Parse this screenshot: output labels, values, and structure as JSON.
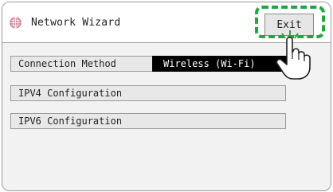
{
  "window": {
    "title": "Network Wizard",
    "icon": "globe-icon"
  },
  "toolbar": {
    "exit_label": "Exit"
  },
  "settings": {
    "connection_method": {
      "label": "Connection Method",
      "value": "Wireless (Wi-Fi)"
    },
    "ipv4": {
      "label": "IPV4 Configuration"
    },
    "ipv6": {
      "label": "IPV6 Configuration"
    }
  },
  "annotation": {
    "highlight_color": "#23a543",
    "pointer": "hand-pointer-icon"
  }
}
